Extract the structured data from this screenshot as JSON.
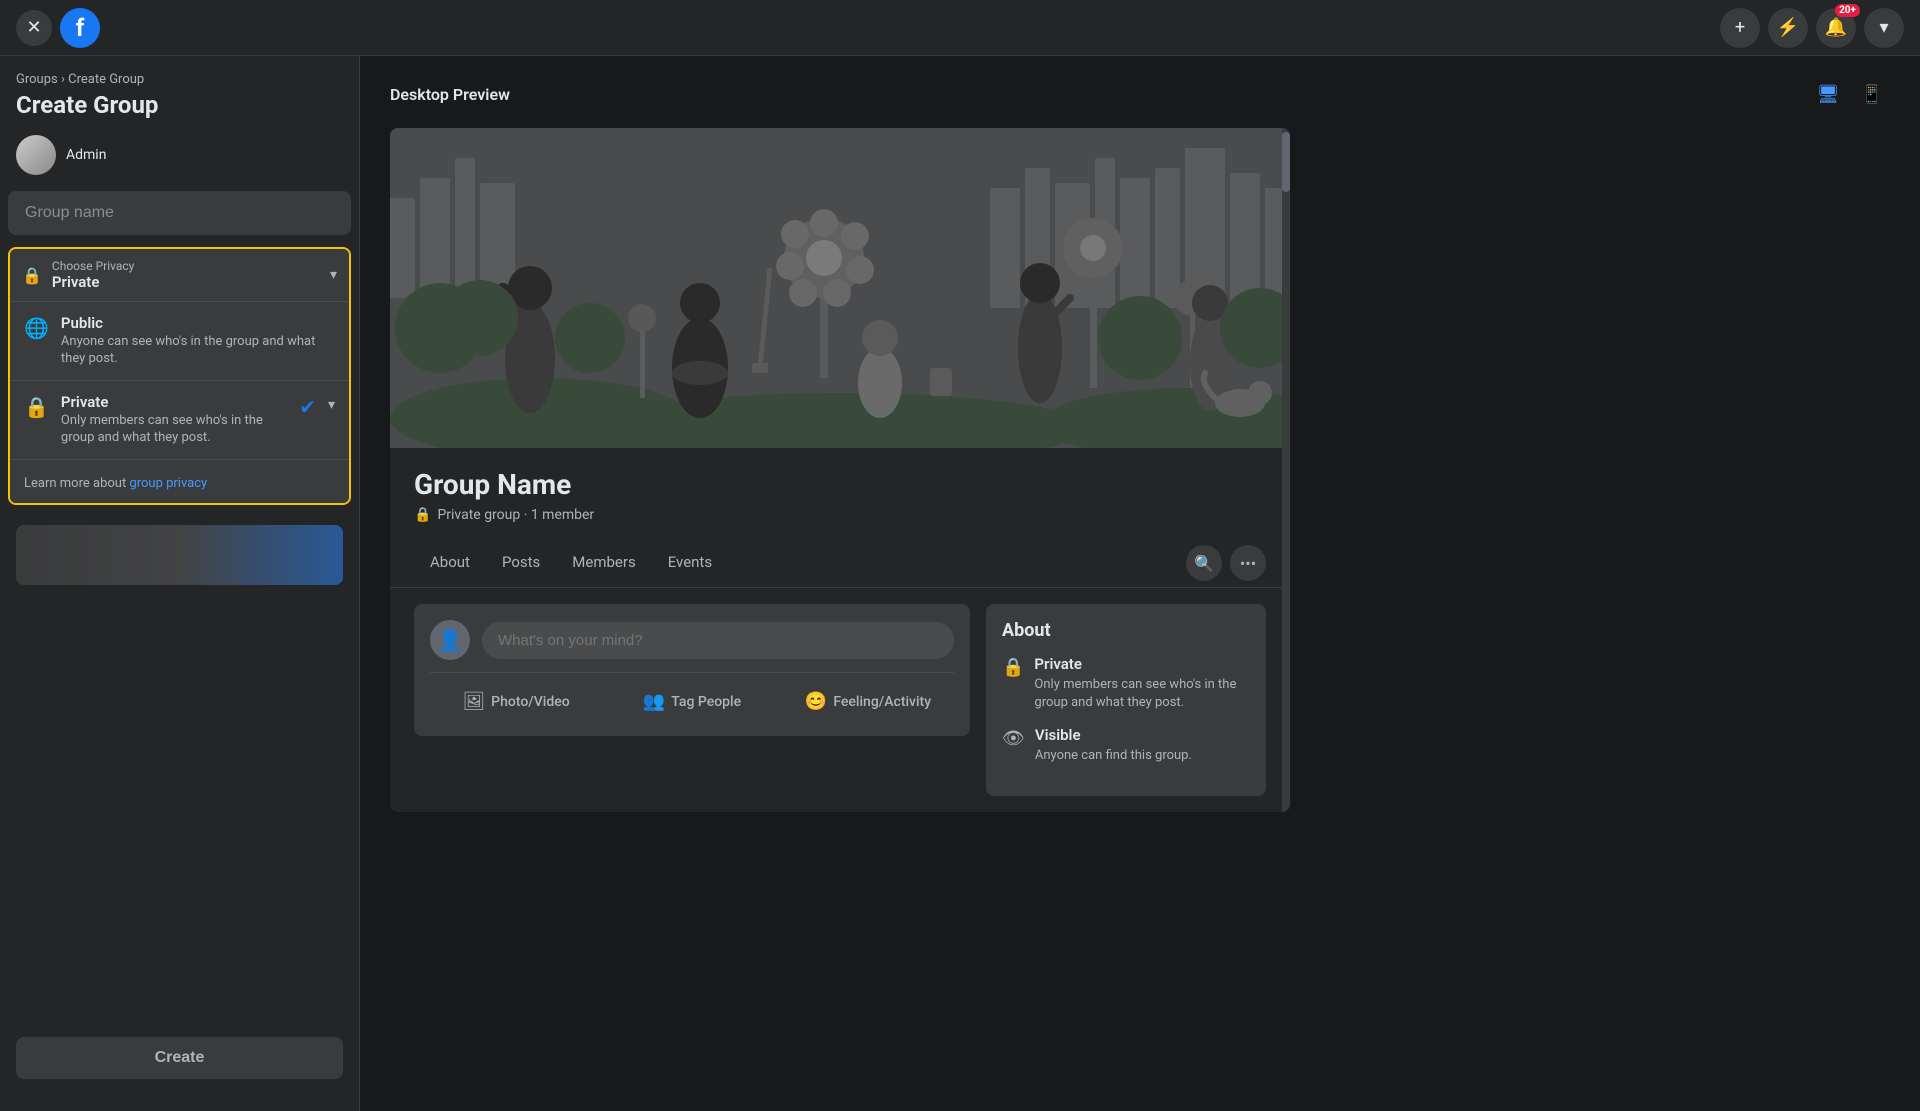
{
  "nav": {
    "close_icon": "✕",
    "fb_logo": "f",
    "add_icon": "+",
    "messenger_icon": "⚡",
    "notification_icon": "🔔",
    "dropdown_icon": "▾",
    "notification_badge": "20+",
    "device_desktop_icon": "🖥",
    "device_tablet_icon": "⬜"
  },
  "left_panel": {
    "breadcrumb": "Groups › Create Group",
    "breadcrumb_groups": "Groups",
    "breadcrumb_separator": " › ",
    "breadcrumb_current": "Create Group",
    "title": "Create Group",
    "admin_label": "Admin",
    "group_name_placeholder": "Group name",
    "privacy_section": {
      "choose_label": "Choose Privacy",
      "current_value": "Private",
      "lock_icon": "🔒",
      "chevron": "▾",
      "options": [
        {
          "title": "Public",
          "description": "Anyone can see who's in the group and what they post.",
          "icon": "🌐",
          "selected": false
        },
        {
          "title": "Private",
          "description": "Only members can see who's in the group and what they post.",
          "icon": "🔒",
          "selected": true
        }
      ],
      "learn_more_prefix": "Learn more about ",
      "learn_more_link": "group privacy"
    },
    "create_button": "Create"
  },
  "preview": {
    "title": "Desktop Preview",
    "group_name": "Group Name",
    "group_meta": "Private group · 1 member",
    "lock_icon": "🔒",
    "tabs": [
      "About",
      "Posts",
      "Members",
      "Events"
    ],
    "post_placeholder": "What's on your mind?",
    "post_actions": [
      {
        "icon": "🖼",
        "label": "Photo/Video"
      },
      {
        "icon": "👤",
        "label": "Tag People"
      },
      {
        "icon": "😊",
        "label": "Feeling/Activity"
      }
    ],
    "about": {
      "title": "About",
      "items": [
        {
          "icon": "🔒",
          "title": "Private",
          "desc": "Only members can see who's in the group and what they post."
        },
        {
          "icon": "👁",
          "title": "Visible",
          "desc": "Anyone can find this group."
        }
      ]
    }
  }
}
